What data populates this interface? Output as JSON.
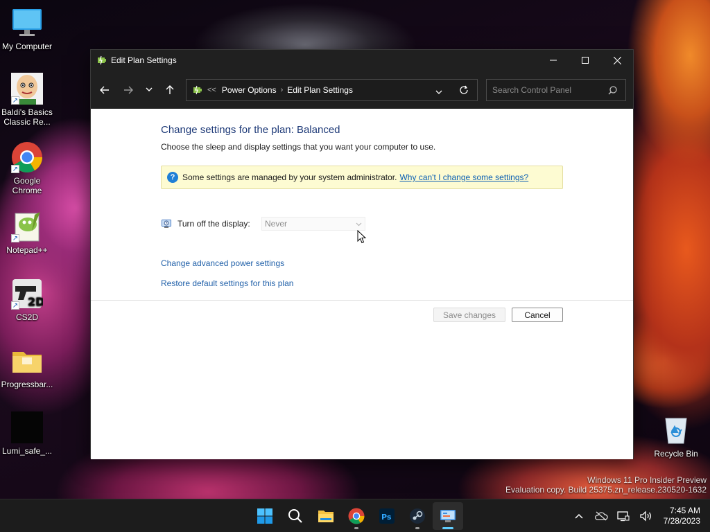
{
  "desktop": {
    "icons": [
      {
        "label": "My Computer",
        "icon": "monitor-icon"
      },
      {
        "label": "Baldi's Basics Classic Re...",
        "icon": "baldi-icon"
      },
      {
        "label": "Google Chrome",
        "icon": "chrome-icon"
      },
      {
        "label": "Notepad++",
        "icon": "notepadpp-icon"
      },
      {
        "label": "CS2D",
        "icon": "cs2d-icon"
      },
      {
        "label": "Progressbar...",
        "icon": "folder-icon"
      },
      {
        "label": "Lumi_safe_...",
        "icon": "black-file-icon"
      },
      {
        "label": "Recycle Bin",
        "icon": "recycle-bin-icon"
      }
    ]
  },
  "window": {
    "title": "Edit Plan Settings",
    "breadcrumb": {
      "prefix": "<<",
      "items": [
        "Power Options",
        "Edit Plan Settings"
      ]
    },
    "search": {
      "placeholder": "Search Control Panel"
    }
  },
  "content": {
    "heading": "Change settings for the plan: Balanced",
    "subheading": "Choose the sleep and display settings that you want your computer to use.",
    "info": {
      "text": "Some settings are managed by your system administrator.",
      "link": "Why can't I change some settings?"
    },
    "display": {
      "label": "Turn off the display:",
      "value": "Never"
    },
    "advanced_link": "Change advanced power settings",
    "restore_link": "Restore default settings for this plan",
    "save_label": "Save changes",
    "cancel_label": "Cancel"
  },
  "watermark": {
    "line1": "Windows 11 Pro Insider Preview",
    "line2": "Evaluation copy. Build 25375.zn_release.230520-1632"
  },
  "taskbar": {
    "apps": [
      "start-icon",
      "search-icon",
      "file-explorer-icon",
      "chrome-icon",
      "photoshop-icon",
      "steam-icon",
      "control-panel-icon"
    ],
    "time": "7:45 AM",
    "date": "7/28/2023"
  },
  "colors": {
    "heading": "#1e3a78",
    "link": "#0b5fb3",
    "accent": "#60cdff",
    "titlebar": "#202020"
  }
}
